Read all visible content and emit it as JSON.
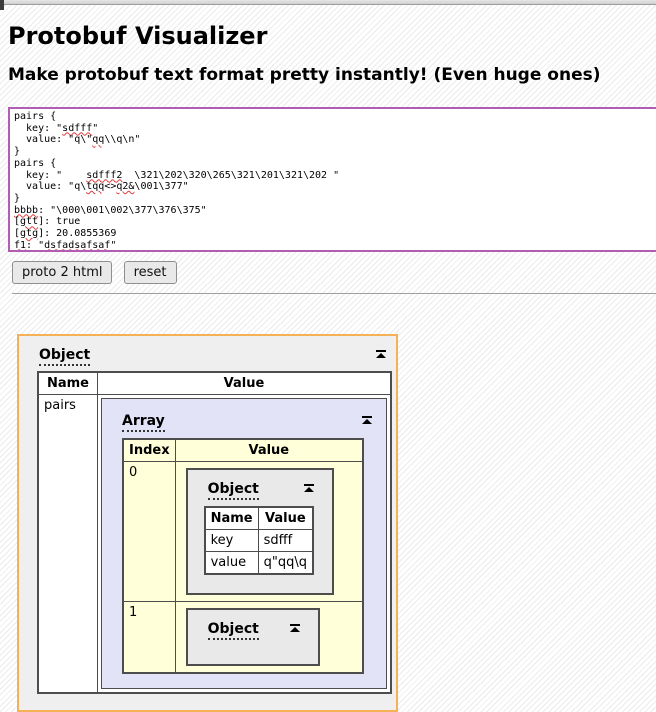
{
  "page": {
    "title": "Protobuf Visualizer",
    "subtitle": "Make protobuf text format pretty instantly! (Even huge ones)"
  },
  "editor": {
    "lines": [
      [
        {
          "t": "pairs {",
          "m": false
        }
      ],
      [
        {
          "t": "  key: \"",
          "m": false
        },
        {
          "t": "sdfff",
          "m": true
        },
        {
          "t": "\"",
          "m": false
        }
      ],
      [
        {
          "t": "  value: \"q\\\"",
          "m": false
        },
        {
          "t": "qq",
          "m": true
        },
        {
          "t": "\\\\q\\n\"",
          "m": false
        }
      ],
      [
        {
          "t": "}",
          "m": false
        }
      ],
      [
        {
          "t": "pairs {",
          "m": false
        }
      ],
      [
        {
          "t": "  key: \"    ",
          "m": false
        },
        {
          "t": "sdfff2",
          "m": true
        },
        {
          "t": "  \\321\\202\\320\\265\\321\\201\\321\\202 \"",
          "m": false
        }
      ],
      [
        {
          "t": "  value: \"q\\",
          "m": false
        },
        {
          "t": "tqq",
          "m": true
        },
        {
          "t": "<>",
          "m": false
        },
        {
          "t": "q2&",
          "m": true
        },
        {
          "t": "\\001\\377\"",
          "m": false
        }
      ],
      [
        {
          "t": "}",
          "m": false
        }
      ],
      [
        {
          "t": "bbbb",
          "m": true
        },
        {
          "t": ": \"\\000\\001\\002\\377\\376\\375\"",
          "m": false
        }
      ],
      [
        {
          "t": "[",
          "m": false
        },
        {
          "t": "gtt",
          "m": true
        },
        {
          "t": "]: true",
          "m": false
        }
      ],
      [
        {
          "t": "[",
          "m": false
        },
        {
          "t": "gtg",
          "m": true
        },
        {
          "t": "]: 20.0855369",
          "m": false
        }
      ],
      [
        {
          "t": "f1",
          "m": true
        },
        {
          "t": ": \"",
          "m": false
        },
        {
          "t": "dsfadsafsaf",
          "m": true
        },
        {
          "t": "\"",
          "m": false
        }
      ]
    ]
  },
  "toolbar": {
    "convert_label": "proto 2 html",
    "reset_label": "reset"
  },
  "result": {
    "root": {
      "label": "Object",
      "columns": [
        "Name",
        "Value"
      ],
      "rows": [
        {
          "name": "pairs"
        }
      ]
    },
    "array": {
      "label": "Array",
      "columns": [
        "Index",
        "Value"
      ],
      "items": [
        {
          "index": "0",
          "object": {
            "label": "Object",
            "columns": [
              "Name",
              "Value"
            ],
            "rows": [
              {
                "name": "key",
                "value": "sdfff"
              },
              {
                "name": "value",
                "value": "q\"qq\\q"
              }
            ]
          }
        },
        {
          "index": "1",
          "object": {
            "label": "Object"
          }
        }
      ]
    }
  },
  "colors": {
    "editor_border": "#b35cb3",
    "result_border": "#f5b155",
    "result_background": "#efefef",
    "array_box_background": "#e3e3f8",
    "array_table_background": "#ffffd9",
    "object_box_background": "#e9e9e9",
    "spellcheck_underline": "#e03c3c"
  }
}
